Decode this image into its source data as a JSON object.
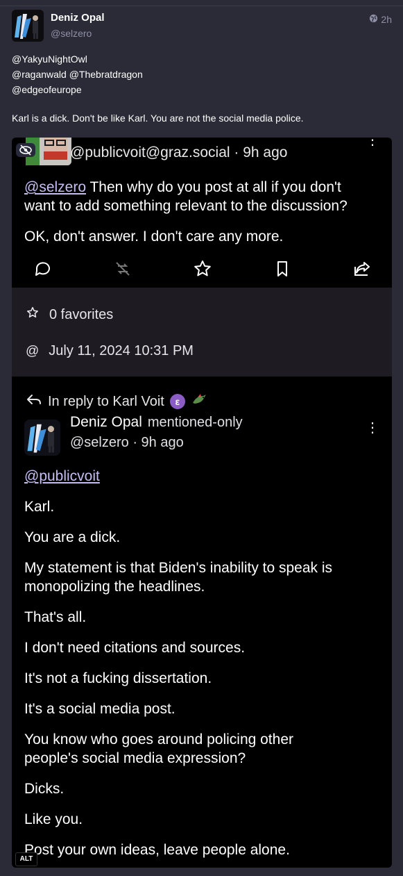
{
  "post": {
    "author_name": "Deniz Opal",
    "author_handle": "@selzero",
    "time": "2h",
    "mentions": [
      "@YakyuNightOwl",
      "@raganwald @Thebratdragon",
      "@edgeofeurope"
    ],
    "text": "Karl is a dick. Don't be like Karl. You are not the social media police."
  },
  "screenshot": {
    "quoted": {
      "meta": "@publicvoit@graz.social · 9h ago",
      "mention": "@selzero",
      "line1_rest": " Then why do you post at all if you don't",
      "line2": "want to add something relevant to the discussion?",
      "line3": "OK, don't answer. I don't care any more."
    },
    "panel": {
      "favorites": "0 favorites",
      "datetime": "July 11, 2024 10:31 PM"
    },
    "reply": {
      "in_reply_to": "In reply to Karl Voit",
      "author_name": "Deniz Opal",
      "visibility": "mentioned-only",
      "meta": "@selzero · 9h ago",
      "mention": "@publicvoit",
      "paragraphs": [
        "Karl.",
        "You are a dick.",
        "My statement is that Biden's inability to speak is",
        "monopolizing the headlines.",
        "That's all.",
        "I don't need citations and sources.",
        "It's not a fucking dissertation.",
        "It's a social media post.",
        "You know who goes around policing other",
        "people's social media expression?",
        "Dicks.",
        "Like you.",
        "Post your own ideas, leave people alone."
      ]
    },
    "alt_label": "ALT"
  },
  "colors": {
    "background": "#2a2b36",
    "muted": "#8f90a8",
    "link": "#c7bdf5"
  }
}
